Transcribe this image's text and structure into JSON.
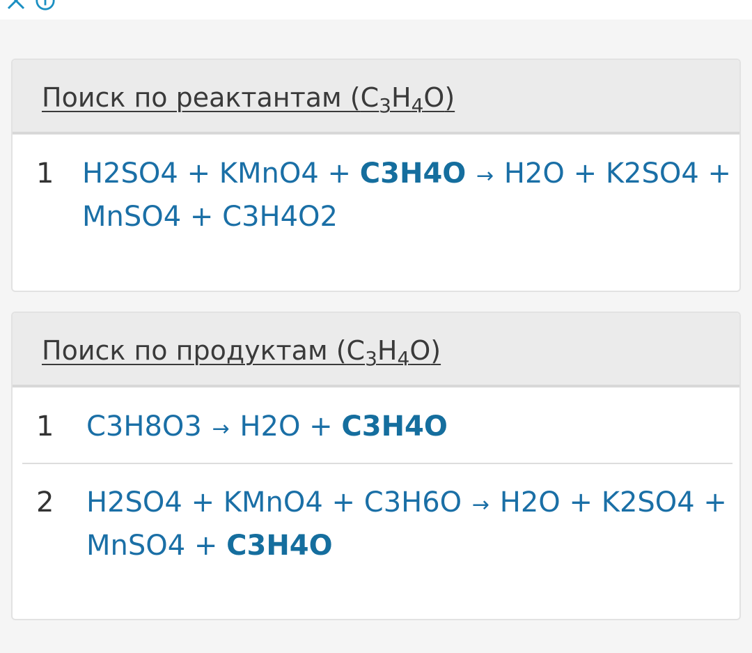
{
  "topbar": {
    "close_icon": "close-icon",
    "info_icon": "info-icon",
    "accent": "#1a8fc2"
  },
  "colors": {
    "link": "#1a6fa6",
    "header_bg": "#ebebeb",
    "page_bg": "#f5f5f5"
  },
  "reactants": {
    "title_prefix": "Поиск по реактантам (",
    "formula": {
      "c": "C",
      "c_sub": "3",
      "h": "H",
      "h_sub": "4",
      "o": "O"
    },
    "title_suffix": ")",
    "rows": [
      {
        "num": "1",
        "line1": {
          "a": "H2SO4 + KMnO4 + ",
          "bold": "C3H4O",
          "arrow": "→",
          "b": "H2O + K2SO4 +"
        },
        "line2": "MnSO4 + C3H4O2"
      }
    ]
  },
  "products": {
    "title_prefix": "Поиск по продуктам (",
    "formula": {
      "c": "C",
      "c_sub": "3",
      "h": "H",
      "h_sub": "4",
      "o": "O"
    },
    "title_suffix": ")",
    "rows": [
      {
        "num": "1",
        "line1": {
          "a": "C3H8O3",
          "arrow": "→",
          "b": "H2O + ",
          "bold": "C3H4O"
        }
      },
      {
        "num": "2",
        "line1": {
          "a": "H2SO4 + KMnO4 + C3H6O",
          "arrow": "→",
          "b": "H2O + K2SO4 +"
        },
        "line2": {
          "a": "MnSO4 + ",
          "bold": "C3H4O"
        }
      }
    ]
  }
}
